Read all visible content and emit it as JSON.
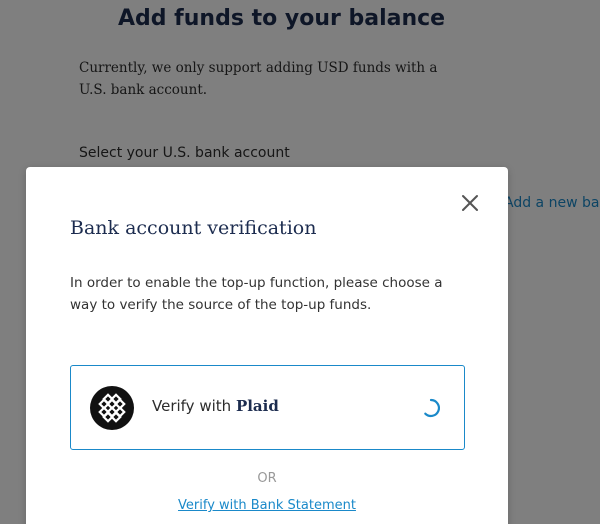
{
  "background_page": {
    "title": "Add funds to your balance",
    "description": "Currently, we only support adding USD funds with a U.S. bank account.",
    "select_label": "Select your U.S. bank account",
    "add_bank_link": "Add a new bank account"
  },
  "modal": {
    "title": "Bank account verification",
    "body": "In order to enable the top-up function, please choose a way to verify the source of the top-up funds.",
    "plaid_option": {
      "prefix": "Verify with",
      "brand": "Plaid",
      "icon": "plaid-logo-icon",
      "loading": true
    },
    "separator": "OR",
    "bank_statement_link": "Verify with Bank Statement",
    "close_icon": "close-icon"
  },
  "colors": {
    "accent": "#1a89c9",
    "heading": "#1c2c4f",
    "overlay": "rgba(0,0,0,0.5)"
  }
}
